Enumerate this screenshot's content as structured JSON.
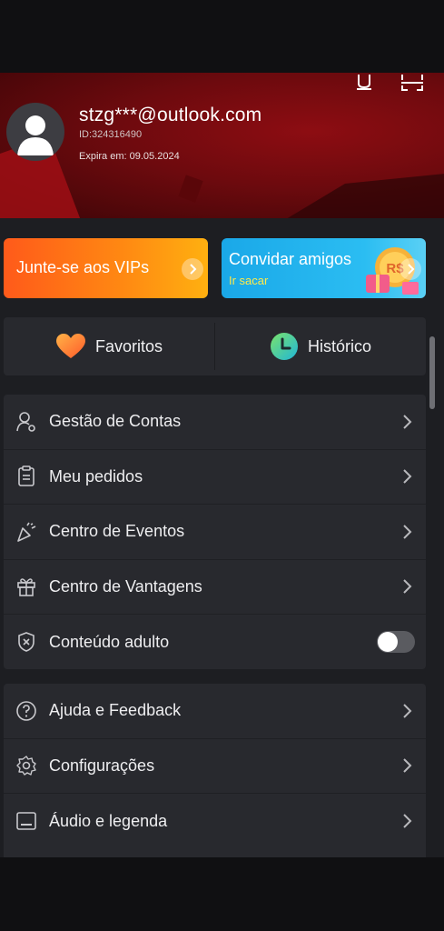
{
  "profile": {
    "email": "stzg***@outlook.com",
    "id": "ID:324316490",
    "expiry": "Expira em: 09.05.2024"
  },
  "header_icons": [
    "notification-icon",
    "scan-icon"
  ],
  "promos": {
    "vip": {
      "label": "Junte-se aos VIPs",
      "color": "#ff7a14"
    },
    "invite": {
      "label": "Convidar amigos",
      "sub": "Ir sacar",
      "badge": "R$",
      "color": "#22b2ee",
      "sub_color": "#ffe94a"
    }
  },
  "quick": {
    "favorites": {
      "label": "Favoritos",
      "icon": "heart-icon"
    },
    "history": {
      "label": "Histórico",
      "icon": "clock-icon"
    }
  },
  "menu_group_1": [
    {
      "label": "Gestão de Contas",
      "icon": "account-manage-icon"
    },
    {
      "label": "Meu pedidos",
      "icon": "orders-icon"
    },
    {
      "label": "Centro de Eventos",
      "icon": "party-popper-icon"
    },
    {
      "label": "Centro de Vantagens",
      "icon": "gift-icon"
    },
    {
      "label": "Conteúdo adulto",
      "icon": "shield-x-icon",
      "toggle": false
    }
  ],
  "menu_group_2": [
    {
      "label": "Ajuda e Feedback",
      "icon": "help-icon"
    },
    {
      "label": "Configurações",
      "icon": "gear-icon"
    },
    {
      "label": "Áudio e legenda",
      "icon": "subtitle-icon"
    }
  ],
  "colors": {
    "header_red": "#7a0b10",
    "background": "#1d1e22",
    "card": "#28292e"
  }
}
